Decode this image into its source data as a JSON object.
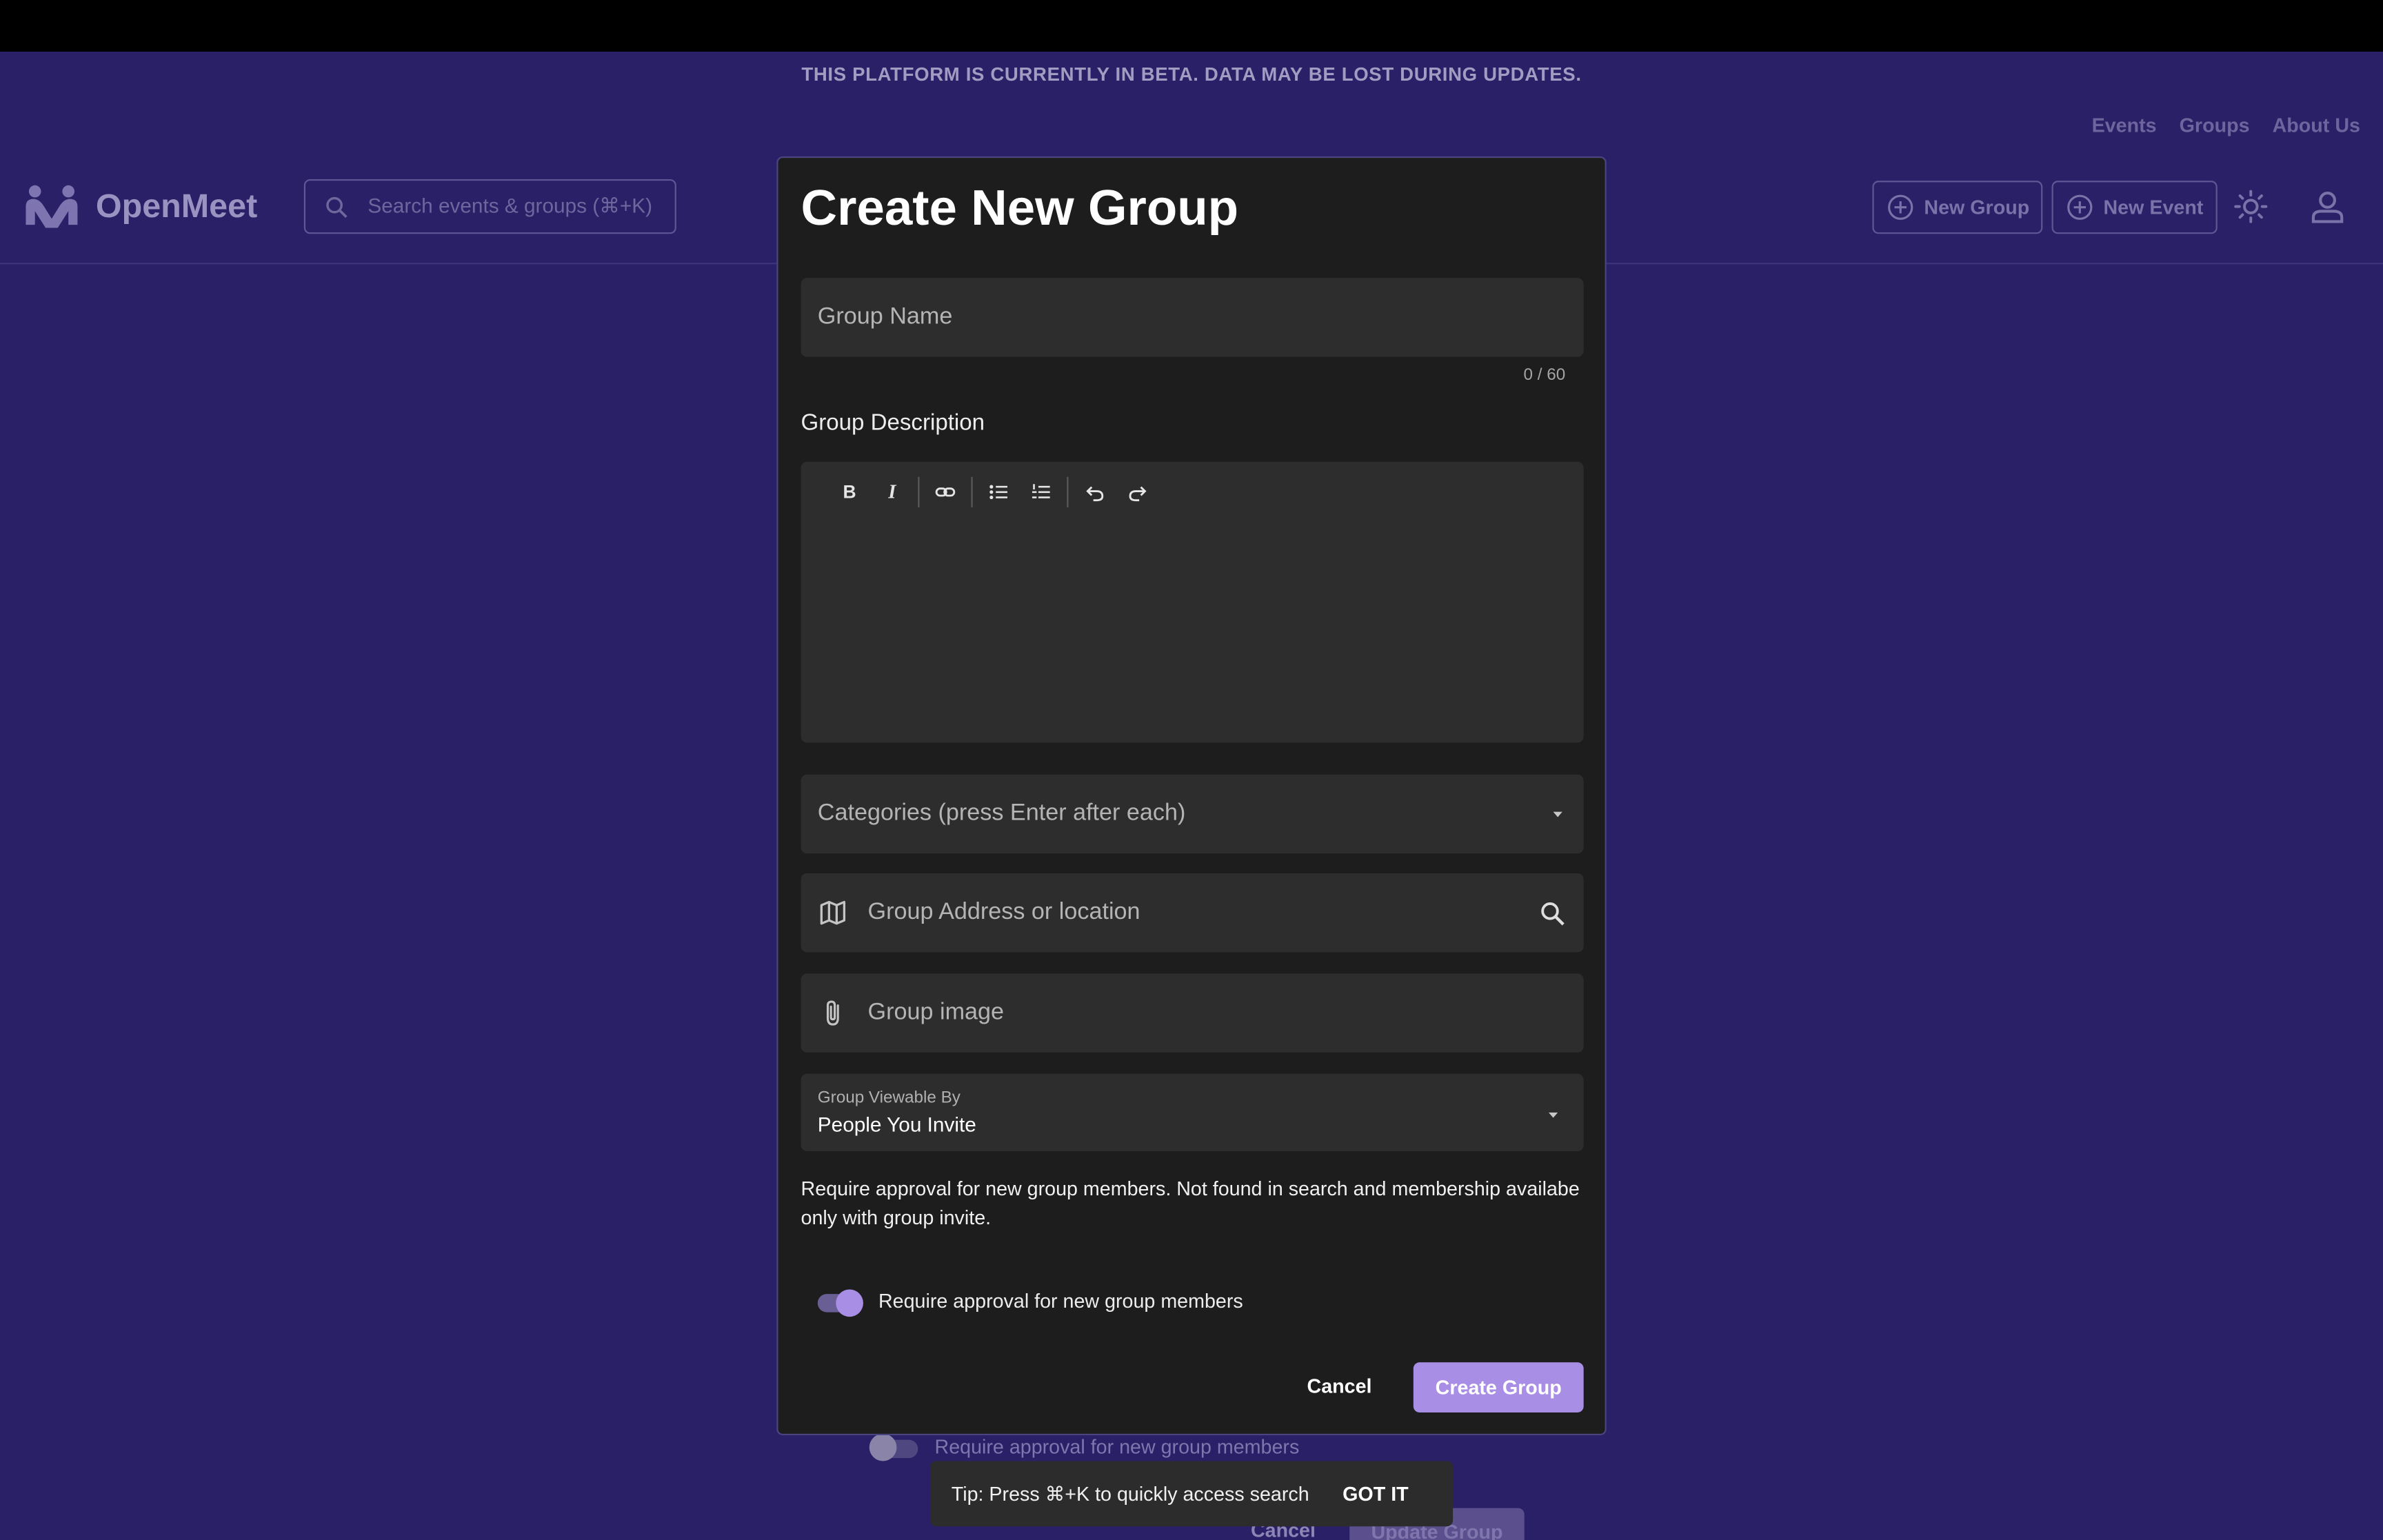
{
  "banner": {
    "text": "THIS PLATFORM IS CURRENTLY IN BETA. DATA MAY BE LOST DURING UPDATES."
  },
  "top_links": [
    "Events",
    "Groups",
    "About Us"
  ],
  "header": {
    "brand": "OpenMeet",
    "search_placeholder": "Search events & groups (⌘+K)",
    "new_group": "New Group",
    "new_event": "New Event"
  },
  "modal": {
    "title": "Create New Group",
    "group_name_placeholder": "Group Name",
    "name_counter": "0 / 60",
    "description_label": "Group Description",
    "toolbar": {
      "bold": "B",
      "italic": "I"
    },
    "categories_placeholder": "Categories (press Enter after each)",
    "address_placeholder": "Group Address or location",
    "image_placeholder": "Group image",
    "visibility": {
      "label": "Group Viewable By",
      "value": "People You Invite"
    },
    "help_text": "Require approval for new group members. Not found in search and membership availabe only with group invite.",
    "approval_toggle": {
      "label": "Require approval for new group members",
      "on": true
    },
    "cancel": "Cancel",
    "submit": "Create Group"
  },
  "background": {
    "approval_label": "Require approval for new group members",
    "cancel": "Cancel",
    "update": "Update Group"
  },
  "snackbar": {
    "text": "Tip: Press ⌘+K to quickly access search",
    "action": "GOT IT"
  },
  "colors": {
    "page_bg": "#2a2067",
    "modal_bg": "#1d1d1d",
    "accent": "#a98ee6"
  }
}
